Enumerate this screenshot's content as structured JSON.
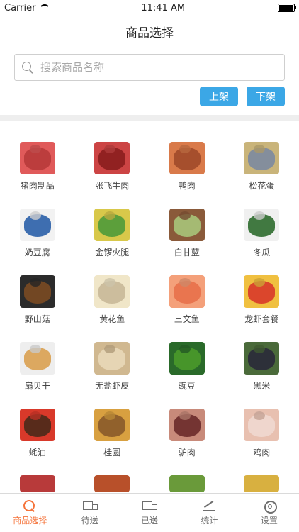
{
  "status_bar": {
    "carrier": "Carrier",
    "time": "11:41 AM"
  },
  "nav": {
    "title": "商品选择"
  },
  "search": {
    "placeholder": "搜索商品名称"
  },
  "actions": {
    "shelve_label": "上架",
    "unshelve_label": "下架"
  },
  "products": [
    {
      "name": "猪肉制品",
      "icon": "meat-icon",
      "color": "#b83a3a",
      "color2": "#e05a5a"
    },
    {
      "name": "张飞牛肉",
      "icon": "beef-icon",
      "color": "#8b1e1e",
      "color2": "#c44"
    },
    {
      "name": "鸭肉",
      "icon": "duck-icon",
      "color": "#a04a2a",
      "color2": "#d97a4a"
    },
    {
      "name": "松花蛋",
      "icon": "egg-icon",
      "color": "#7c8aa0",
      "color2": "#c9b47a"
    },
    {
      "name": "奶豆腐",
      "icon": "milk-tofu-icon",
      "color": "#2a5fa8",
      "color2": "#f2f2f2"
    },
    {
      "name": "金锣火腿",
      "icon": "ham-icon",
      "color": "#4f9a3a",
      "color2": "#d8c84a"
    },
    {
      "name": "白甘蓝",
      "icon": "cabbage-icon",
      "color": "#a7c47a",
      "color2": "#8a5a3a"
    },
    {
      "name": "冬瓜",
      "icon": "wax-gourd-icon",
      "color": "#2e6b2e",
      "color2": "#f0f0f0"
    },
    {
      "name": "野山菇",
      "icon": "mushroom-icon",
      "color": "#7a4a22",
      "color2": "#2b2b2b"
    },
    {
      "name": "黄花鱼",
      "icon": "fish-icon",
      "color": "#c8b898",
      "color2": "#f0e6c8"
    },
    {
      "name": "三文鱼",
      "icon": "salmon-icon",
      "color": "#e8704a",
      "color2": "#f4a07a"
    },
    {
      "name": "龙虾套餐",
      "icon": "lobster-icon",
      "color": "#d8392a",
      "color2": "#f0c040"
    },
    {
      "name": "扇贝干",
      "icon": "scallop-icon",
      "color": "#d9a050",
      "color2": "#eeeeee"
    },
    {
      "name": "无盐虾皮",
      "icon": "shrimp-icon",
      "color": "#e8d8b8",
      "color2": "#d0b890"
    },
    {
      "name": "豌豆",
      "icon": "pea-icon",
      "color": "#4a9a2a",
      "color2": "#2a6a2a"
    },
    {
      "name": "黑米",
      "icon": "black-rice-icon",
      "color": "#2a2a3a",
      "color2": "#4a6a3a"
    },
    {
      "name": "蚝油",
      "icon": "oyster-sauce-icon",
      "color": "#4a2a1a",
      "color2": "#d8392a"
    },
    {
      "name": "桂圆",
      "icon": "longan-icon",
      "color": "#8a5a2a",
      "color2": "#d8a040"
    },
    {
      "name": "驴肉",
      "icon": "donkey-meat-icon",
      "color": "#6a2a2a",
      "color2": "#c88a7a"
    },
    {
      "name": "鸡肉",
      "icon": "chicken-icon",
      "color": "#f0d8d0",
      "color2": "#e8c0b0"
    }
  ],
  "partial_row": [
    {
      "icon": "meat-icon",
      "color": "#b83a3a"
    },
    {
      "icon": "chicken-icon",
      "color": "#b8502a"
    },
    {
      "icon": "vegetable-icon",
      "color": "#6a9a3a"
    },
    {
      "icon": "package-icon",
      "color": "#d8b040"
    }
  ],
  "tabbar": [
    {
      "label": "商品选择",
      "icon": "search-grid-icon",
      "active": true
    },
    {
      "label": "待送",
      "icon": "truck-icon",
      "active": false
    },
    {
      "label": "已送",
      "icon": "truck-done-icon",
      "active": false
    },
    {
      "label": "统计",
      "icon": "chart-icon",
      "active": false
    },
    {
      "label": "设置",
      "icon": "gear-icon",
      "active": false
    }
  ],
  "colors": {
    "accent": "#3ba7e6",
    "active_tab": "#f5733a"
  }
}
